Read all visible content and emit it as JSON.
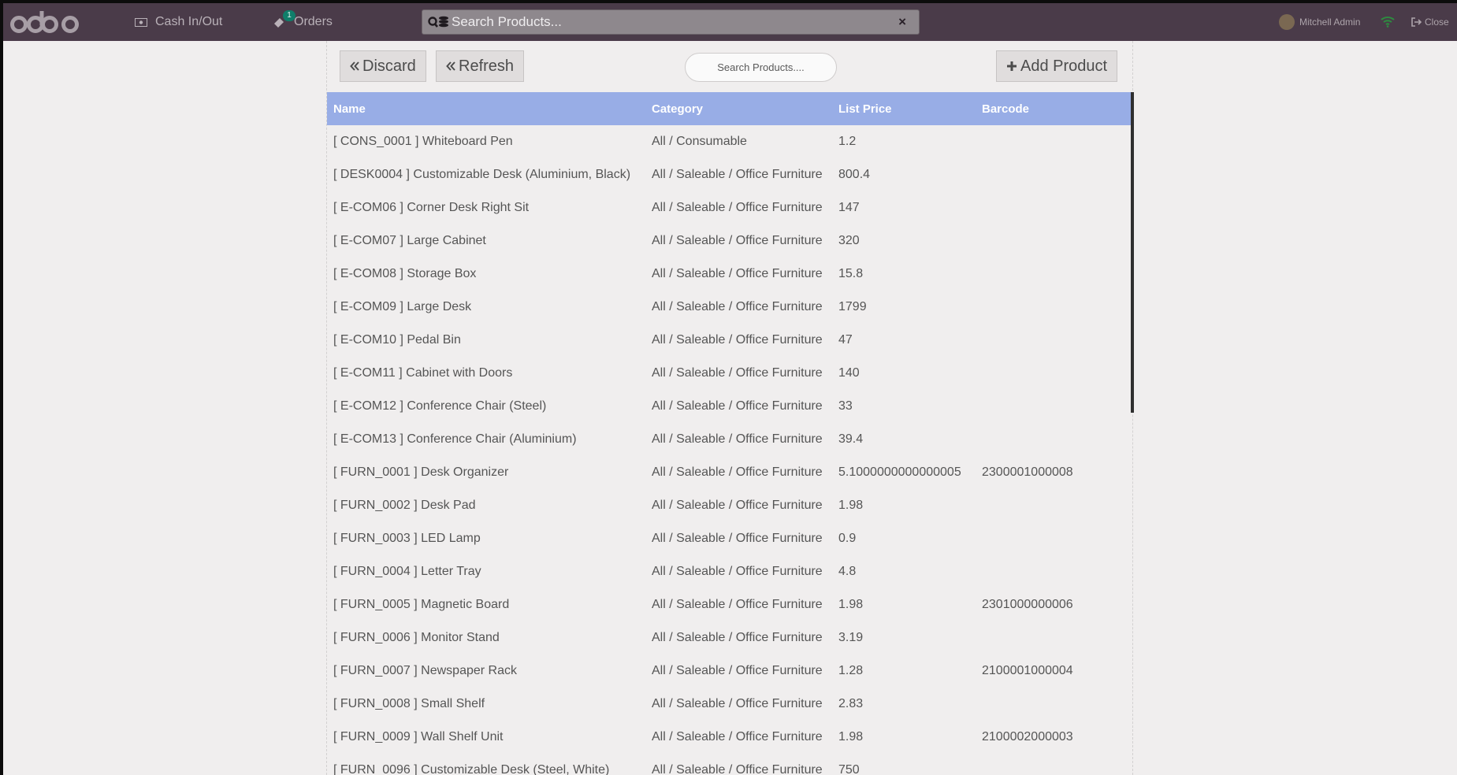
{
  "navbar": {
    "logo_text": "odoo",
    "cash_label": "Cash In/Out",
    "orders_label": "Orders",
    "orders_badge": "1",
    "search_placeholder": "Search Products...",
    "clear_icon": "×",
    "user_name": "Mitchell Admin",
    "close_label": "Close"
  },
  "toolbar": {
    "discard_label": "Discard",
    "refresh_label": "Refresh",
    "search_placeholder": "Search Products....",
    "add_label": "Add Product"
  },
  "table": {
    "headers": [
      "Name",
      "Category",
      "List Price",
      "Barcode"
    ],
    "rows": [
      {
        "name": "[ CONS_0001 ] Whiteboard Pen",
        "category": "All / Consumable",
        "price": "1.2",
        "barcode": ""
      },
      {
        "name": "[ DESK0004 ] Customizable Desk (Aluminium, Black)",
        "category": "All / Saleable / Office Furniture",
        "price": "800.4",
        "barcode": ""
      },
      {
        "name": "[ E-COM06 ] Corner Desk Right Sit",
        "category": "All / Saleable / Office Furniture",
        "price": "147",
        "barcode": ""
      },
      {
        "name": "[ E-COM07 ] Large Cabinet",
        "category": "All / Saleable / Office Furniture",
        "price": "320",
        "barcode": ""
      },
      {
        "name": "[ E-COM08 ] Storage Box",
        "category": "All / Saleable / Office Furniture",
        "price": "15.8",
        "barcode": ""
      },
      {
        "name": "[ E-COM09 ] Large Desk",
        "category": "All / Saleable / Office Furniture",
        "price": "1799",
        "barcode": ""
      },
      {
        "name": "[ E-COM10 ] Pedal Bin",
        "category": "All / Saleable / Office Furniture",
        "price": "47",
        "barcode": ""
      },
      {
        "name": "[ E-COM11 ] Cabinet with Doors",
        "category": "All / Saleable / Office Furniture",
        "price": "140",
        "barcode": ""
      },
      {
        "name": "[ E-COM12 ] Conference Chair (Steel)",
        "category": "All / Saleable / Office Furniture",
        "price": "33",
        "barcode": ""
      },
      {
        "name": "[ E-COM13 ] Conference Chair (Aluminium)",
        "category": "All / Saleable / Office Furniture",
        "price": "39.4",
        "barcode": ""
      },
      {
        "name": "[ FURN_0001 ] Desk Organizer",
        "category": "All / Saleable / Office Furniture",
        "price": "5.1000000000000005",
        "barcode": "2300001000008"
      },
      {
        "name": "[ FURN_0002 ] Desk Pad",
        "category": "All / Saleable / Office Furniture",
        "price": "1.98",
        "barcode": ""
      },
      {
        "name": "[ FURN_0003 ] LED Lamp",
        "category": "All / Saleable / Office Furniture",
        "price": "0.9",
        "barcode": ""
      },
      {
        "name": "[ FURN_0004 ] Letter Tray",
        "category": "All / Saleable / Office Furniture",
        "price": "4.8",
        "barcode": ""
      },
      {
        "name": "[ FURN_0005 ] Magnetic Board",
        "category": "All / Saleable / Office Furniture",
        "price": "1.98",
        "barcode": "2301000000006"
      },
      {
        "name": "[ FURN_0006 ] Monitor Stand",
        "category": "All / Saleable / Office Furniture",
        "price": "3.19",
        "barcode": ""
      },
      {
        "name": "[ FURN_0007 ] Newspaper Rack",
        "category": "All / Saleable / Office Furniture",
        "price": "1.28",
        "barcode": "2100001000004"
      },
      {
        "name": "[ FURN_0008 ] Small Shelf",
        "category": "All / Saleable / Office Furniture",
        "price": "2.83",
        "barcode": ""
      },
      {
        "name": "[ FURN_0009 ] Wall Shelf Unit",
        "category": "All / Saleable / Office Furniture",
        "price": "1.98",
        "barcode": "2100002000003"
      },
      {
        "name": "[ FURN_0096 ] Customizable Desk (Steel, White)",
        "category": "All / Saleable / Office Furniture",
        "price": "750",
        "barcode": ""
      }
    ]
  },
  "colors": {
    "navbar": "#4a3b49",
    "table_header": "#98ade6",
    "background": "#f0eeee"
  }
}
